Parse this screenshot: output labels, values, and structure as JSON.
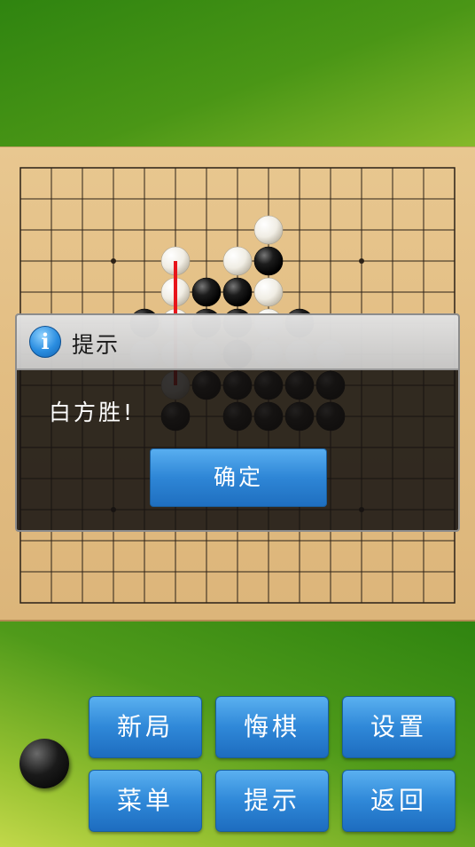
{
  "board": {
    "size": 15,
    "line_color": "#2b2117",
    "star_points": [
      [
        3,
        3
      ],
      [
        11,
        3
      ],
      [
        7,
        7
      ],
      [
        3,
        11
      ],
      [
        11,
        11
      ]
    ],
    "stones": [
      {
        "col": 8,
        "row": 2,
        "color": "white"
      },
      {
        "col": 5,
        "row": 3,
        "color": "white"
      },
      {
        "col": 7,
        "row": 3,
        "color": "white"
      },
      {
        "col": 8,
        "row": 3,
        "color": "black"
      },
      {
        "col": 5,
        "row": 4,
        "color": "white"
      },
      {
        "col": 6,
        "row": 4,
        "color": "black"
      },
      {
        "col": 7,
        "row": 4,
        "color": "black"
      },
      {
        "col": 8,
        "row": 4,
        "color": "white"
      },
      {
        "col": 4,
        "row": 5,
        "color": "black"
      },
      {
        "col": 5,
        "row": 5,
        "color": "white"
      },
      {
        "col": 6,
        "row": 5,
        "color": "black"
      },
      {
        "col": 7,
        "row": 5,
        "color": "black"
      },
      {
        "col": 8,
        "row": 5,
        "color": "white"
      },
      {
        "col": 9,
        "row": 5,
        "color": "black"
      },
      {
        "col": 4,
        "row": 6,
        "color": "white"
      },
      {
        "col": 5,
        "row": 6,
        "color": "white"
      },
      {
        "col": 6,
        "row": 6,
        "color": "white"
      },
      {
        "col": 7,
        "row": 6,
        "color": "black"
      },
      {
        "col": 8,
        "row": 6,
        "color": "white"
      },
      {
        "col": 9,
        "row": 6,
        "color": "white"
      },
      {
        "col": 10,
        "row": 6,
        "color": "white"
      },
      {
        "col": 5,
        "row": 7,
        "color": "white"
      },
      {
        "col": 6,
        "row": 7,
        "color": "black"
      },
      {
        "col": 7,
        "row": 7,
        "color": "black"
      },
      {
        "col": 8,
        "row": 7,
        "color": "black"
      },
      {
        "col": 9,
        "row": 7,
        "color": "black"
      },
      {
        "col": 10,
        "row": 7,
        "color": "black"
      },
      {
        "col": 5,
        "row": 8,
        "color": "black"
      },
      {
        "col": 7,
        "row": 8,
        "color": "black"
      },
      {
        "col": 8,
        "row": 8,
        "color": "black"
      },
      {
        "col": 9,
        "row": 8,
        "color": "black"
      },
      {
        "col": 10,
        "row": 8,
        "color": "black"
      }
    ],
    "win_line": {
      "from": [
        5,
        3
      ],
      "to": [
        5,
        7
      ],
      "color": "#e8151a"
    }
  },
  "dialog": {
    "icon": "info-icon",
    "icon_glyph": "i",
    "title": "提示",
    "message": "白方胜!",
    "ok_label": "确定"
  },
  "controls": {
    "current_turn": "black",
    "buttons": [
      {
        "id": "new-game",
        "label": "新局"
      },
      {
        "id": "undo",
        "label": "悔棋"
      },
      {
        "id": "settings",
        "label": "设置"
      },
      {
        "id": "menu",
        "label": "菜单"
      },
      {
        "id": "hint",
        "label": "提示"
      },
      {
        "id": "back",
        "label": "返回"
      }
    ]
  }
}
